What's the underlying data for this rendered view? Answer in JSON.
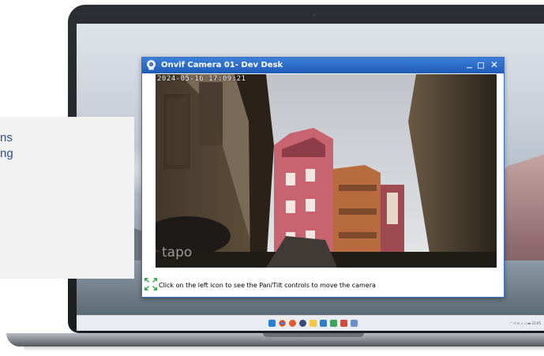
{
  "camera_window": {
    "title": "Onvif Camera 01- Dev Desk",
    "timestamp": "2024-05-16 17:09:21",
    "watermark": "tapo",
    "status_text": "Click on the left icon to see the Pan/Tilt controls to move the camera",
    "close_glyph": "✕"
  },
  "caption_card": {
    "line1": "ns",
    "line2": "ng"
  },
  "taskbar": {
    "icons": [
      "windows-start-icon",
      "chrome-icon",
      "app-icon",
      "settings-icon",
      "folder-icon",
      "app-icon",
      "app-icon",
      "app-icon",
      "app-icon"
    ],
    "tray_text": "^ ⊡ ⊡ ≈ ◁ ▬ 23:05"
  },
  "colors": {
    "title_bar": "#1f5bb8",
    "caption_text": "#2c4f86"
  }
}
